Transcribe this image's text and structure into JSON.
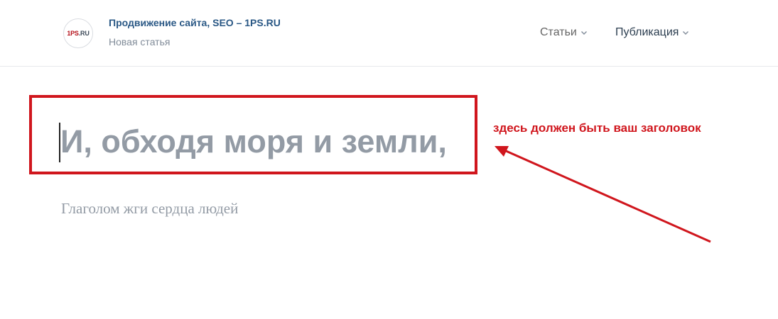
{
  "header": {
    "logo": {
      "text_red": "1PS",
      "text_dark": ".RU"
    },
    "site_title": "Продвижение сайта, SEO – 1PS.RU",
    "page_subtitle": "Новая статья",
    "nav": {
      "articles_label": "Статьи",
      "publish_label": "Публикация"
    }
  },
  "editor": {
    "title_value": "И, обходя моря и земли,",
    "subtitle_value": "Глаголом жги сердца людей"
  },
  "annotation": {
    "text": "здесь должен быть ваш заголовок",
    "color": "#d0161d"
  },
  "colors": {
    "link_blue": "#2a5885",
    "muted_gray": "#818c99",
    "placeholder_gray": "#939ba5",
    "highlight_red": "#d0161d"
  },
  "icons": {
    "nav_chevron": "chevron-down-icon",
    "annotation_arrow": "arrow-icon"
  }
}
